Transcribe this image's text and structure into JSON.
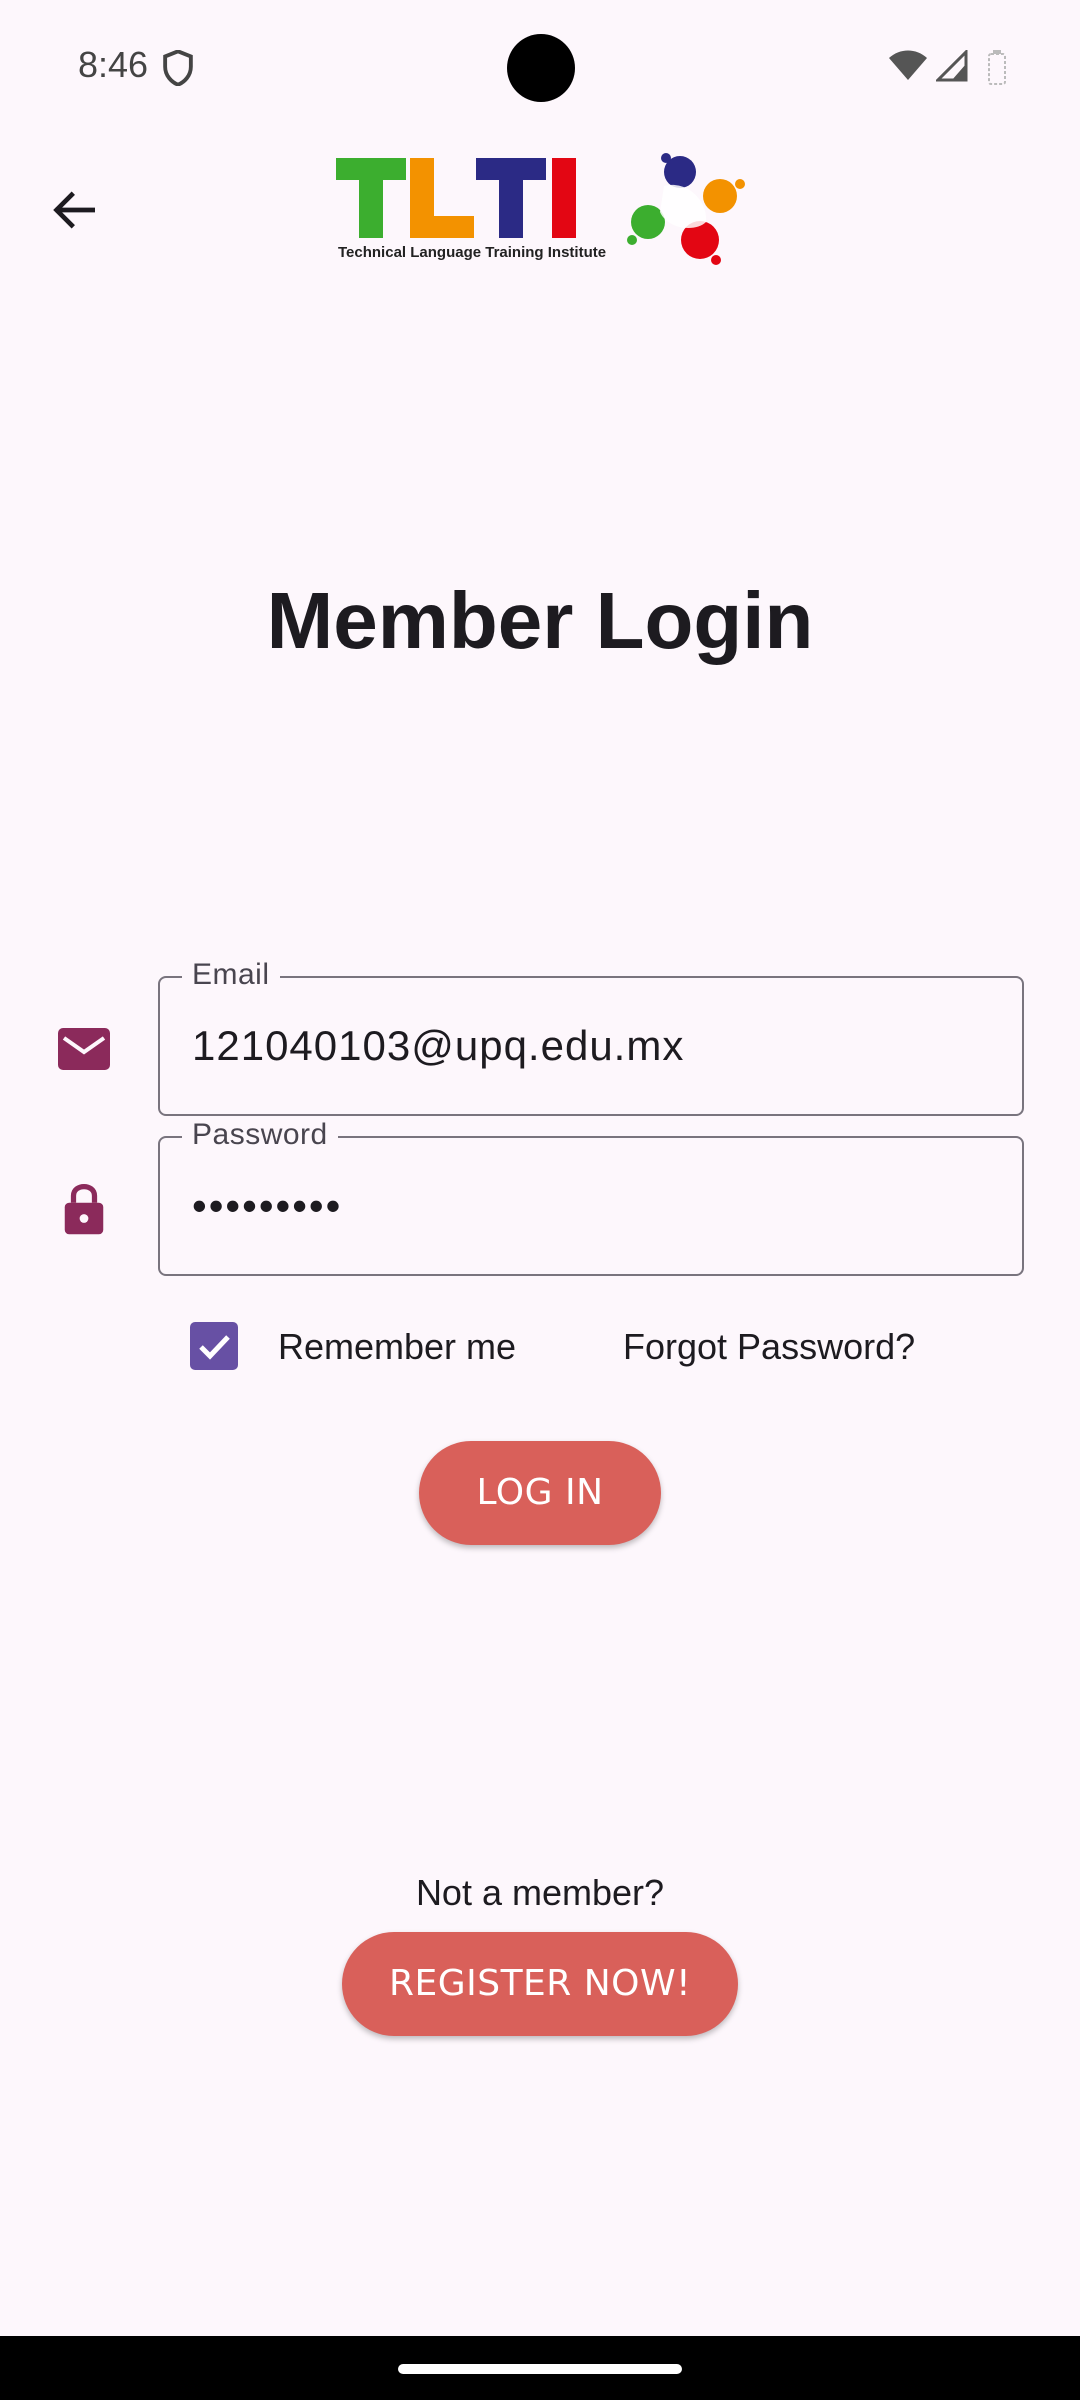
{
  "status_bar": {
    "time": "8:46"
  },
  "header": {
    "logo_text": "TLTI",
    "logo_subtitle": "Technical Language Training Institute"
  },
  "page": {
    "title": "Member Login"
  },
  "form": {
    "email_label": "Email",
    "email_value": "121040103@upq.edu.mx",
    "password_label": "Password",
    "password_value": "•••••••••",
    "remember_checked": true,
    "remember_label": "Remember me",
    "forgot_label": "Forgot Password?",
    "login_label": "LOG IN"
  },
  "footer": {
    "prompt": "Not a member?",
    "register_label": "REGISTER NOW!"
  },
  "colors": {
    "accent_button": "#d9605a",
    "icon": "#8b2a5b",
    "checkbox": "#6750a4",
    "logo_green": "#3cae2f",
    "logo_orange": "#f39200",
    "logo_navy": "#2b2a85",
    "logo_red": "#e30613"
  }
}
